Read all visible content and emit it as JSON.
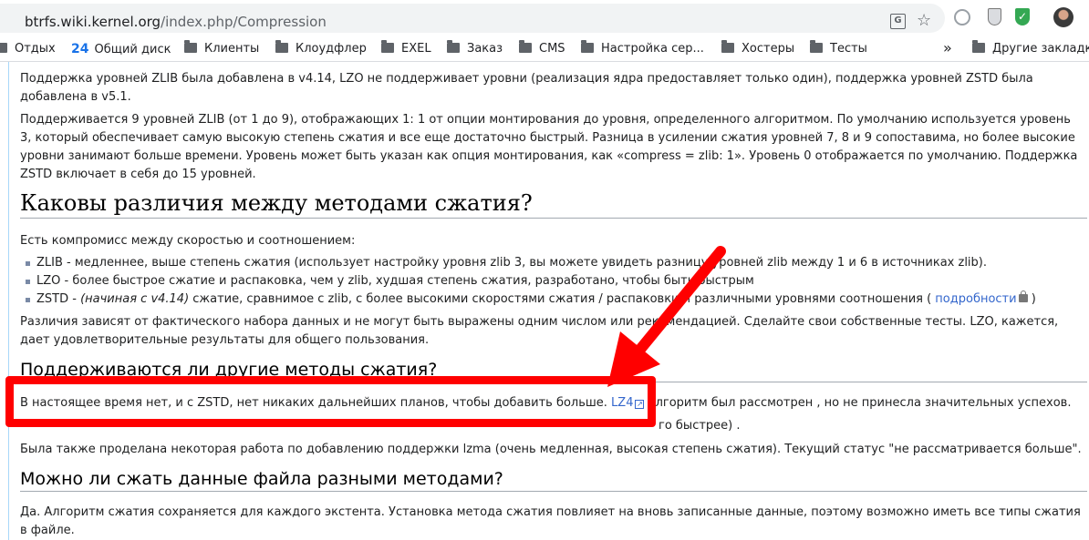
{
  "browser": {
    "url_host": "btrfs.wiki.kernel.org",
    "url_path": "/index.php/Compression"
  },
  "bookmarks": [
    {
      "label": "Отдых",
      "icon": "folder-icon"
    },
    {
      "label": "Общий диск",
      "icon": "number-24-icon"
    },
    {
      "label": "Клиенты",
      "icon": "folder-icon"
    },
    {
      "label": "Клоудфлер",
      "icon": "folder-icon"
    },
    {
      "label": "EXEL",
      "icon": "folder-icon"
    },
    {
      "label": "Заказ",
      "icon": "folder-icon"
    },
    {
      "label": "CMS",
      "icon": "folder-icon"
    },
    {
      "label": "Настройка сер...",
      "icon": "folder-icon"
    },
    {
      "label": "Хостеры",
      "icon": "folder-icon"
    },
    {
      "label": "Тесты",
      "icon": "folder-icon"
    },
    {
      "label": "Другие закладки",
      "icon": "folder-icon"
    }
  ],
  "bookmarks_more": "»",
  "bookmark_24": "24",
  "article": {
    "p1": "Поддержка уровней ZLIB была добавлена в v4.14, LZO не поддерживает уровни (реализация ядра предоставляет только один), поддержка уровней ZSTD была добавлена в v5.1.",
    "p2": "Поддерживается 9 уровней ZLIB (от 1 до 9), отображающих 1: 1 от опции монтирования до уровня, определенного алгоритмом. По умолчанию используется уровень 3, который обеспечивает самую высокую степень сжатия и все еще достаточно быстрый. Разница в усилении сжатия уровней 7, 8 и 9 сопоставима, но более высокие уровни занимают больше времени. Уровень может быть указан как опция монтирования, как «compress = zlib: 1». Уровень 0 отображается по умолчанию. Поддержка ZSTD включает в себя до 15 уровней.",
    "h1": "Каковы различия между методами сжатия?",
    "p3": "Есть компромисс между скоростью и соотношением:",
    "li1": "ZLIB - медленнее, выше степень сжатия (использует настройку уровня zlib 3, вы можете увидеть разницу уровней zlib между 1 и 6 в источниках zlib).",
    "li2": "LZO - более быстрое сжатие и распаковка, чем у zlib, худшая степень сжатия, разработано, чтобы быть быстрым",
    "li3_prefix": "ZSTD - ",
    "li3_italic": "(начиная с v4.14)",
    "li3_text": " сжатие, сравнимое с zlib, с более высокими скоростями сжатия / распаковки и различными уровнями соотношения ( ",
    "li3_link": "подробности",
    "li3_suffix": " )",
    "p4": "Различия зависят от фактического набора данных и не могут быть выражены одним числом или рекомендацией. Сделайте свои собственные тесты. LZO, кажется, дает удовлетворительные результаты для общего пользования.",
    "h2": "Поддерживаются ли другие методы сжатия?",
    "p5_prefix": "В настоящее время нет, и с ZSTD, нет никаких дальнейших планов, чтобы добавить больше. ",
    "p5_link": "LZ4",
    "p5_suffix": " алгоритм был рассмотрен , но не принесла значительных успехов.",
    "p6_visible": "го быстрее) .",
    "p7": "Была также проделана некоторая работа по добавлению поддержки lzma (очень медленная, высокая степень сжатия). Текущий статус \"не рассматривается больше\".",
    "h3": "Можно ли сжать данные файла разными методами?",
    "p8": "Да. Алгоритм сжатия сохраняется для каждого экстента. Установка метода сжатия повлияет на вновь записанные данные, поэтому возможно иметь все типы сжатия в файле."
  },
  "colors": {
    "annotation_red": "#ff0000",
    "link": "#3366cc",
    "text": "#202122"
  }
}
